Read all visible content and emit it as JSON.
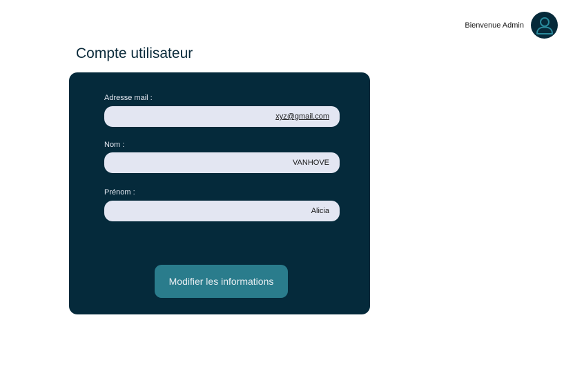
{
  "header": {
    "welcome": "Bienvenue Admin",
    "avatar_icon": "user-avatar-icon"
  },
  "page": {
    "title": "Compte utilisateur"
  },
  "form": {
    "email": {
      "label": "Adresse mail :",
      "value": "xyz@gmail.com"
    },
    "nom": {
      "label": "Nom :",
      "value": "VANHOVE"
    },
    "prenom": {
      "label": "Prénom :",
      "value": "Alicia"
    },
    "submit_label": "Modifier les informations"
  },
  "colors": {
    "card_bg": "#052a3b",
    "input_bg": "#e3e6f2",
    "button_bg": "#2a7c8c",
    "avatar_bg": "#062a3a",
    "avatar_stroke": "#2a8a9c"
  }
}
